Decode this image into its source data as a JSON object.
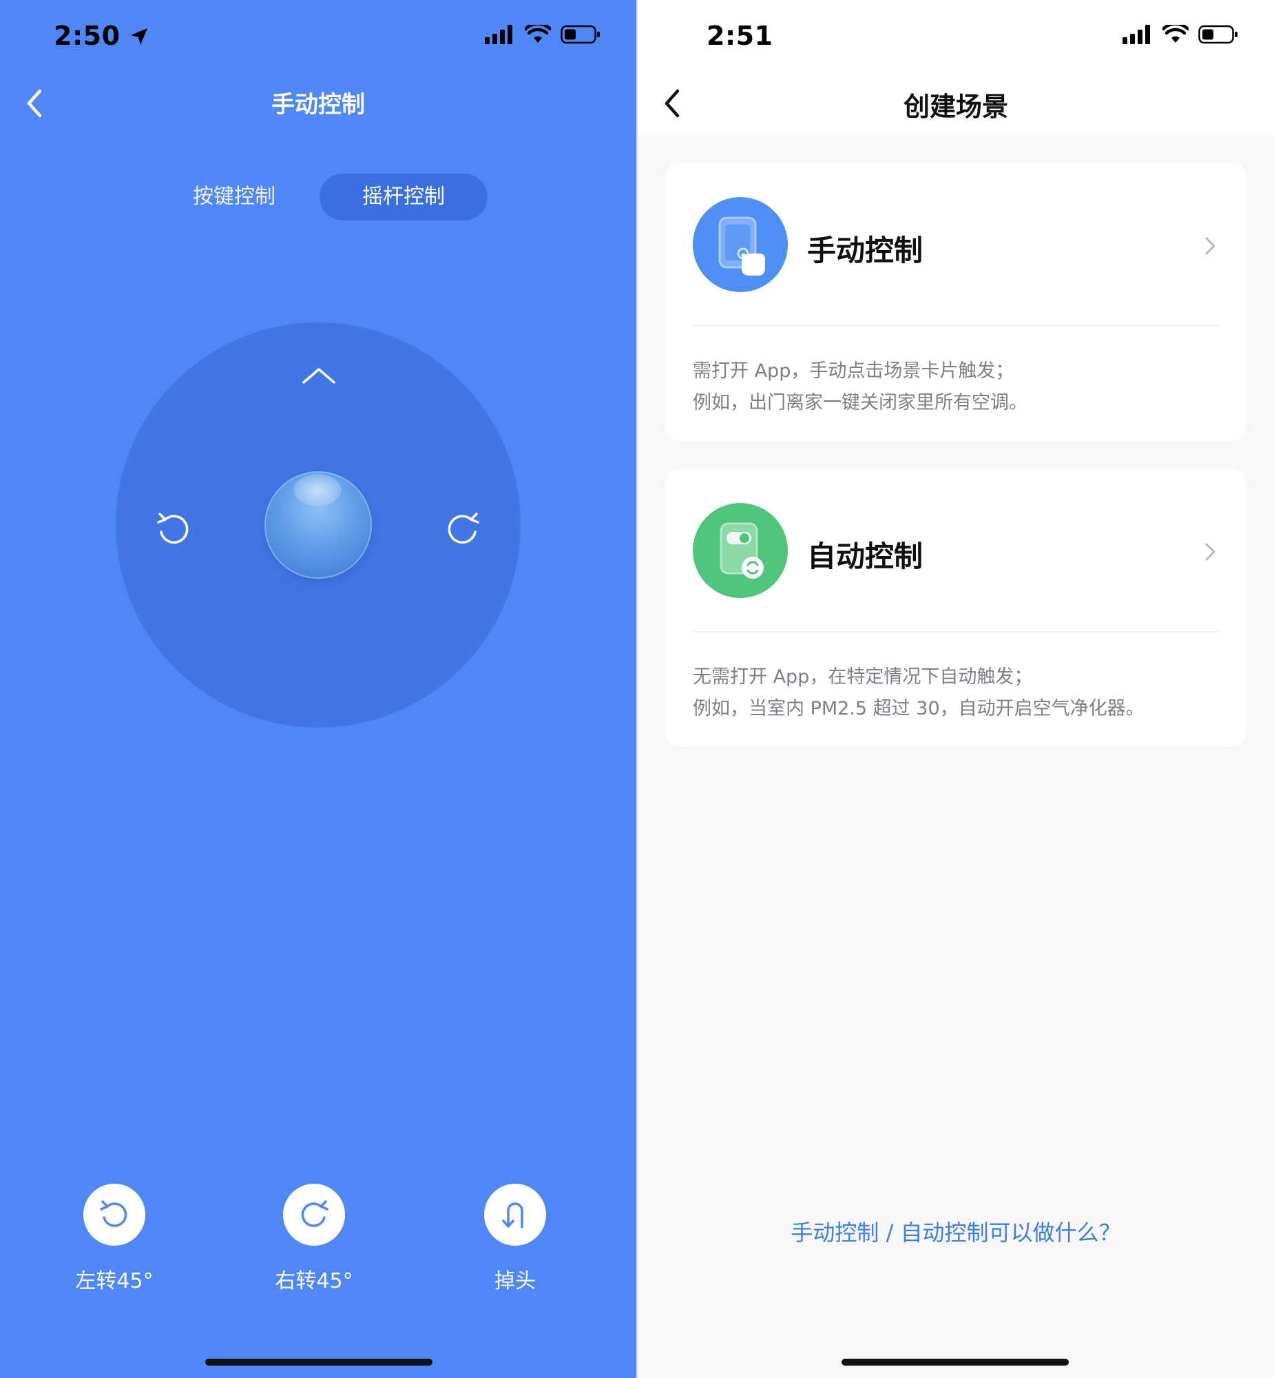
{
  "left": {
    "status": {
      "time": "2:50"
    },
    "nav": {
      "title": "手动控制"
    },
    "tabs": [
      {
        "label": "按键控制",
        "selected": false
      },
      {
        "label": "摇杆控制",
        "selected": true
      }
    ],
    "joystick": {
      "icons": [
        "chevron-up-icon",
        "rotate-left-icon",
        "rotate-right-icon"
      ]
    },
    "actions": [
      {
        "label": "左转45°",
        "icon": "rotate-left-icon"
      },
      {
        "label": "右转45°",
        "icon": "rotate-right-icon"
      },
      {
        "label": "掉头",
        "icon": "u-turn-icon"
      }
    ],
    "colors": {
      "background": "#4f87f6",
      "pad": "#4376e4",
      "selected_tab": "#3b6fdf"
    }
  },
  "right": {
    "status": {
      "time": "2:51"
    },
    "nav": {
      "title": "创建场景"
    },
    "cards": [
      {
        "title": "手动控制",
        "desc_line1": "需打开 App，手动点击场景卡片触发；",
        "desc_line2": "例如，出门离家一键关闭家里所有空调。",
        "icon": "tap-phone-icon",
        "color": "#4f8ef2"
      },
      {
        "title": "自动控制",
        "desc_line1": "无需打开 App，在特定情况下自动触发；",
        "desc_line2": "例如，当室内 PM2.5 超过 30，自动开启空气净化器。",
        "icon": "auto-sync-phone-icon",
        "color": "#4fc47d"
      }
    ],
    "help_link": "手动控制 / 自动控制可以做什么？",
    "colors": {
      "link": "#3d7fe8"
    }
  }
}
